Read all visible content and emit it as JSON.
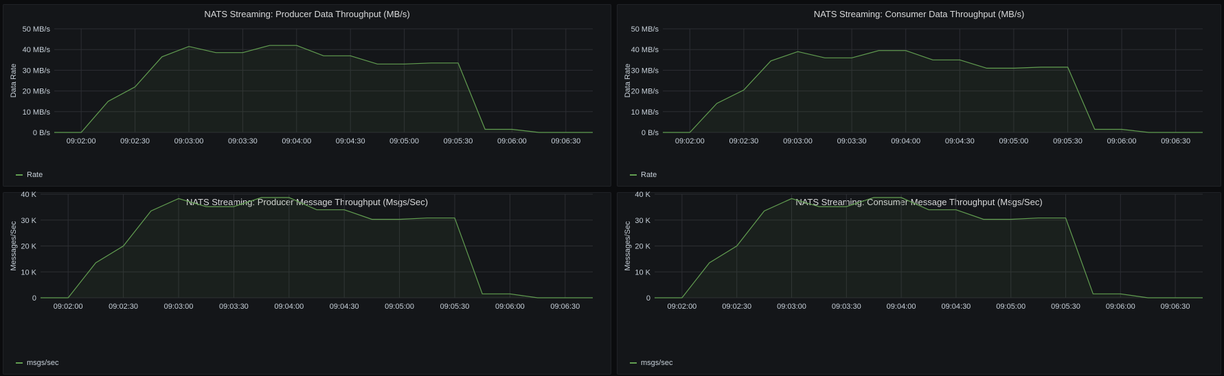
{
  "theme": {
    "series_color": "#629e51",
    "fill_color": "rgba(98,158,81,0.08)",
    "grid_color": "#2c2e33"
  },
  "panels": [
    {
      "title": "NATS Streaming: Producer Data Throughput (MB/s)",
      "legend_label": "Rate"
    },
    {
      "title": "NATS Streaming: Consumer Data Throughput (MB/s)",
      "legend_label": "Rate"
    },
    {
      "title": "NATS Streaming: Producer Message Throughput (Msgs/Sec)",
      "legend_label": "msgs/sec"
    },
    {
      "title": "NATS Streaming: Consumer Message Throughput (Msgs/Sec)",
      "legend_label": "msgs/sec"
    }
  ],
  "chart_data": [
    {
      "type": "area",
      "title": "NATS Streaming: Producer Data Throughput (MB/s)",
      "xlabel": "",
      "ylabel": "Data Rate",
      "x": [
        "09:01:45",
        "09:02:00",
        "09:02:15",
        "09:02:30",
        "09:02:45",
        "09:03:00",
        "09:03:15",
        "09:03:30",
        "09:03:45",
        "09:04:00",
        "09:04:15",
        "09:04:30",
        "09:04:45",
        "09:05:00",
        "09:05:15",
        "09:05:30",
        "09:05:45",
        "09:06:00",
        "09:06:15",
        "09:06:30",
        "09:06:45"
      ],
      "series": [
        {
          "name": "Rate",
          "values": [
            0,
            0,
            15,
            22,
            36.5,
            41.5,
            38.5,
            38.5,
            42,
            42,
            37,
            37,
            33,
            33,
            33.5,
            33.5,
            1.5,
            1.5,
            0,
            0,
            0
          ]
        }
      ],
      "xticks": [
        "09:02:00",
        "09:02:30",
        "09:03:00",
        "09:03:30",
        "09:04:00",
        "09:04:30",
        "09:05:00",
        "09:05:30",
        "09:06:00",
        "09:06:30"
      ],
      "yticks": [
        0,
        10,
        20,
        30,
        40,
        50
      ],
      "ytick_labels": [
        "0 B/s",
        "10 MB/s",
        "20 MB/s",
        "30 MB/s",
        "40 MB/s",
        "50 MB/s"
      ],
      "ylim": [
        0,
        50
      ],
      "xlim": [
        "09:01:45",
        "09:06:45"
      ],
      "grid": true,
      "legend": "bottom-left"
    },
    {
      "type": "area",
      "title": "NATS Streaming: Consumer Data Throughput (MB/s)",
      "xlabel": "",
      "ylabel": "Data Rate",
      "x": [
        "09:01:45",
        "09:02:00",
        "09:02:15",
        "09:02:30",
        "09:02:45",
        "09:03:00",
        "09:03:15",
        "09:03:30",
        "09:03:45",
        "09:04:00",
        "09:04:15",
        "09:04:30",
        "09:04:45",
        "09:05:00",
        "09:05:15",
        "09:05:30",
        "09:05:45",
        "09:06:00",
        "09:06:15",
        "09:06:30",
        "09:06:45"
      ],
      "series": [
        {
          "name": "Rate",
          "values": [
            0,
            0,
            14,
            20.5,
            34.5,
            39,
            36,
            36,
            39.5,
            39.5,
            35,
            35,
            31,
            31,
            31.5,
            31.5,
            1.5,
            1.5,
            0,
            0,
            0
          ]
        }
      ],
      "xticks": [
        "09:02:00",
        "09:02:30",
        "09:03:00",
        "09:03:30",
        "09:04:00",
        "09:04:30",
        "09:05:00",
        "09:05:30",
        "09:06:00",
        "09:06:30"
      ],
      "yticks": [
        0,
        10,
        20,
        30,
        40,
        50
      ],
      "ytick_labels": [
        "0 B/s",
        "10 MB/s",
        "20 MB/s",
        "30 MB/s",
        "40 MB/s",
        "50 MB/s"
      ],
      "ylim": [
        0,
        50
      ],
      "xlim": [
        "09:01:45",
        "09:06:45"
      ],
      "grid": true,
      "legend": "bottom-left"
    },
    {
      "type": "area",
      "title": "NATS Streaming: Producer Message Throughput (Msgs/Sec)",
      "xlabel": "",
      "ylabel": "Messages/Sec",
      "x": [
        "09:01:45",
        "09:02:00",
        "09:02:15",
        "09:02:30",
        "09:02:45",
        "09:03:00",
        "09:03:15",
        "09:03:30",
        "09:03:45",
        "09:04:00",
        "09:04:15",
        "09:04:30",
        "09:04:45",
        "09:05:00",
        "09:05:15",
        "09:05:30",
        "09:05:45",
        "09:06:00",
        "09:06:15",
        "09:06:30",
        "09:06:45"
      ],
      "series": [
        {
          "name": "msgs/sec",
          "values": [
            0,
            0,
            13500,
            20000,
            33500,
            38300,
            35200,
            35200,
            38700,
            38700,
            34000,
            34000,
            30300,
            30300,
            30800,
            30800,
            1500,
            1500,
            0,
            0,
            0
          ]
        }
      ],
      "xticks": [
        "09:02:00",
        "09:02:30",
        "09:03:00",
        "09:03:30",
        "09:04:00",
        "09:04:30",
        "09:05:00",
        "09:05:30",
        "09:06:00",
        "09:06:30"
      ],
      "yticks": [
        0,
        10000,
        20000,
        30000,
        40000
      ],
      "ytick_labels": [
        "0",
        "10 K",
        "20 K",
        "30 K",
        "40 K"
      ],
      "ylim": [
        0,
        40000
      ],
      "xlim": [
        "09:01:45",
        "09:06:45"
      ],
      "grid": true,
      "legend": "bottom-left"
    },
    {
      "type": "area",
      "title": "NATS Streaming: Consumer Message Throughput (Msgs/Sec)",
      "xlabel": "",
      "ylabel": "Messages/Sec",
      "x": [
        "09:01:45",
        "09:02:00",
        "09:02:15",
        "09:02:30",
        "09:02:45",
        "09:03:00",
        "09:03:15",
        "09:03:30",
        "09:03:45",
        "09:04:00",
        "09:04:15",
        "09:04:30",
        "09:04:45",
        "09:05:00",
        "09:05:15",
        "09:05:30",
        "09:05:45",
        "09:06:00",
        "09:06:15",
        "09:06:30",
        "09:06:45"
      ],
      "series": [
        {
          "name": "msgs/sec",
          "values": [
            0,
            0,
            13500,
            20000,
            33500,
            38300,
            35200,
            35200,
            38700,
            38700,
            34000,
            34000,
            30300,
            30300,
            30800,
            30800,
            1500,
            1500,
            0,
            0,
            0
          ]
        }
      ],
      "xticks": [
        "09:02:00",
        "09:02:30",
        "09:03:00",
        "09:03:30",
        "09:04:00",
        "09:04:30",
        "09:05:00",
        "09:05:30",
        "09:06:00",
        "09:06:30"
      ],
      "yticks": [
        0,
        10000,
        20000,
        30000,
        40000
      ],
      "ytick_labels": [
        "0",
        "10 K",
        "20 K",
        "30 K",
        "40 K"
      ],
      "ylim": [
        0,
        40000
      ],
      "xlim": [
        "09:01:45",
        "09:06:45"
      ],
      "grid": true,
      "legend": "bottom-left"
    }
  ]
}
